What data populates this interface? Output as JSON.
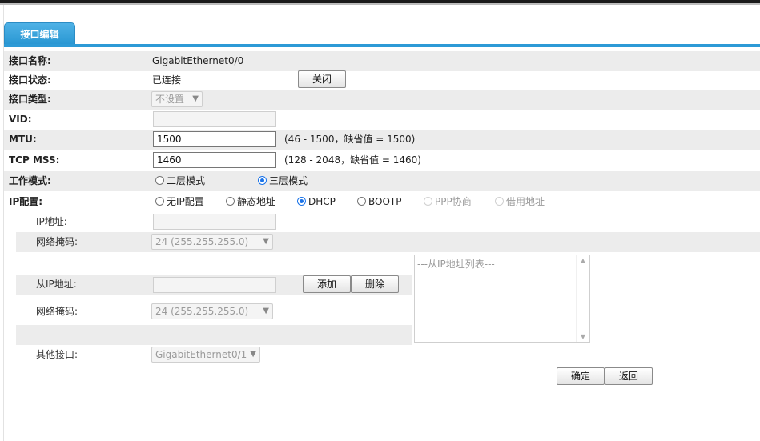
{
  "tab": {
    "label": "接口编辑"
  },
  "fields": {
    "name": {
      "label": "接口名称:",
      "value": "GigabitEthernet0/0"
    },
    "status": {
      "label": "接口状态:",
      "value": "已连接",
      "close_button": "关闭"
    },
    "type": {
      "label": "接口类型:",
      "value": "不设置"
    },
    "vid": {
      "label": "VID:",
      "value": ""
    },
    "mtu": {
      "label": "MTU:",
      "value": "1500",
      "hint": "(46 - 1500，缺省值 = 1500)"
    },
    "tcp_mss": {
      "label": "TCP MSS:",
      "value": "1460",
      "hint": "(128 - 2048，缺省值 = 1460)"
    },
    "work_mode": {
      "label": "工作模式:",
      "options": [
        {
          "label": "二层模式",
          "checked": false
        },
        {
          "label": "三层模式",
          "checked": true
        }
      ]
    },
    "ip_config": {
      "label": "IP配置:",
      "options": [
        {
          "label": "无IP配置",
          "checked": false,
          "disabled": false
        },
        {
          "label": "静态地址",
          "checked": false,
          "disabled": false
        },
        {
          "label": "DHCP",
          "checked": true,
          "disabled": false
        },
        {
          "label": "BOOTP",
          "checked": false,
          "disabled": false
        },
        {
          "label": "PPP协商",
          "checked": false,
          "disabled": true
        },
        {
          "label": "借用地址",
          "checked": false,
          "disabled": true
        }
      ]
    },
    "ip_address": {
      "label": "IP地址:",
      "value": ""
    },
    "netmask": {
      "label": "网络掩码:",
      "value": "24 (255.255.255.0)"
    },
    "secondary_ip": {
      "label": "从IP地址:",
      "value": "",
      "add_button": "添加",
      "delete_button": "删除",
      "list_placeholder": "---从IP地址列表---"
    },
    "secondary_netmask": {
      "label": "网络掩码:",
      "value": "24 (255.255.255.0)"
    },
    "other_interface": {
      "label": "其他接口:",
      "value": "GigabitEthernet0/1"
    }
  },
  "actions": {
    "ok": "确定",
    "back": "返回"
  }
}
